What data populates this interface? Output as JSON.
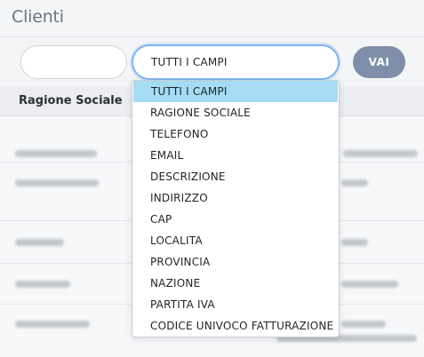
{
  "page": {
    "title": "Clienti"
  },
  "search": {
    "input_value": "",
    "field_select_value": "TUTTI I CAMPI",
    "go_label": "VAI"
  },
  "table": {
    "columns": [
      "Ragione Sociale"
    ]
  },
  "dropdown": {
    "options": [
      "TUTTI I CAMPI",
      "RAGIONE SOCIALE",
      "TELEFONO",
      "EMAIL",
      "DESCRIZIONE",
      "INDIRIZZO",
      "CAP",
      "LOCALITA",
      "PROVINCIA",
      "NAZIONE",
      "PARTITA IVA",
      "CODICE UNIVOCO FATTURAZIONE"
    ],
    "selected_index": 0
  },
  "colors": {
    "accent": "#7fb4f0",
    "button": "#7f8faa",
    "selected_option": "#a5dcf3"
  }
}
